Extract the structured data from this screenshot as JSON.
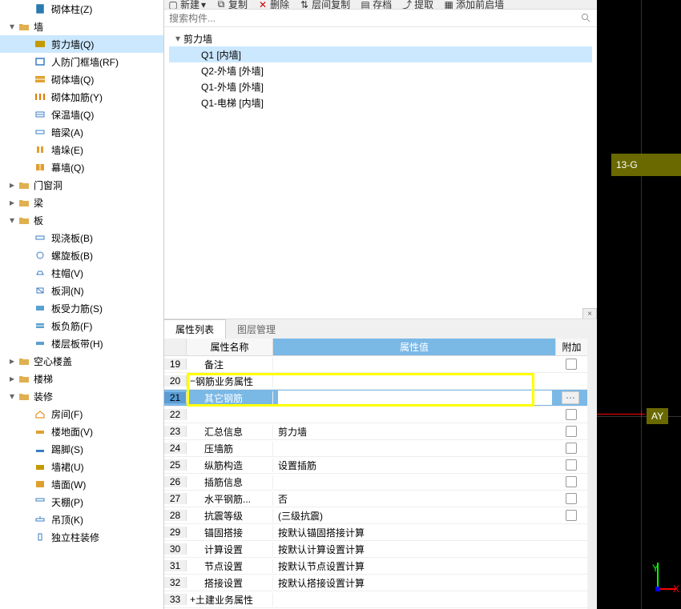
{
  "toolbar": {
    "new": "新建",
    "copy": "复制",
    "delete": "删除",
    "layercopy": "层间复制",
    "save": "存档",
    "extract": "提取",
    "addStartup": "添加前启墙"
  },
  "search": {
    "placeholder": "搜索构件..."
  },
  "left_tree": {
    "masonry_col": "砌体柱(Z)",
    "wall": "墙",
    "wall_children": {
      "shear": "剪力墙(Q)",
      "civil": "人防门框墙(RF)",
      "masonry": "砌体墙(Q)",
      "reinf": "砌体加筋(Y)",
      "insul": "保温墙(Q)",
      "dark": "暗梁(A)",
      "stack": "墙垛(E)",
      "curtain": "幕墙(Q)"
    },
    "door": "门窗洞",
    "beam": "梁",
    "slab": "板",
    "slab_children": {
      "cast": "现浇板(B)",
      "spiral": "螺旋板(B)",
      "cap": "柱帽(V)",
      "hole": "板洞(N)",
      "bar": "板受力筋(S)",
      "neg": "板负筋(F)",
      "strip": "楼层板带(H)"
    },
    "hollow": "空心楼盖",
    "stair": "楼梯",
    "deco": "装修",
    "deco_children": {
      "room": "房间(F)",
      "floor": "楼地面(V)",
      "skirt": "踢脚(S)",
      "wainscot": "墙裙(U)",
      "wallface": "墙面(W)",
      "ceiling": "天棚(P)",
      "suspend": "吊顶(K)",
      "indep": "独立柱装修"
    }
  },
  "comp_tree": {
    "root": "剪力墙",
    "items": {
      "q1in": "Q1 [内墙]",
      "q2out": "Q2-外墙 [外墙]",
      "q1out": "Q1-外墙 [外墙]",
      "q1lift": "Q1-电梯 [内墙]"
    }
  },
  "tabs": {
    "prop": "属性列表",
    "layer": "图层管理"
  },
  "headers": {
    "name": "属性名称",
    "value": "属性值",
    "extra": "附加"
  },
  "rows": [
    {
      "n": "19",
      "name": "备注",
      "value": "",
      "chk": true
    },
    {
      "n": "20",
      "name": "钢筋业务属性",
      "value": "",
      "cat": true
    },
    {
      "n": "21",
      "name": "其它钢筋",
      "value": "",
      "sel": true
    },
    {
      "n": "22",
      "name": "",
      "value": "",
      "chk": true
    },
    {
      "n": "23",
      "name": "汇总信息",
      "value": "剪力墙",
      "chk": true
    },
    {
      "n": "24",
      "name": "压墙筋",
      "value": "",
      "chk": true
    },
    {
      "n": "25",
      "name": "纵筋构造",
      "value": "设置插筋",
      "chk": true
    },
    {
      "n": "26",
      "name": "插筋信息",
      "value": "",
      "chk": true
    },
    {
      "n": "27",
      "name": "水平钢筋...",
      "value": "否",
      "chk": true
    },
    {
      "n": "28",
      "name": "抗震等级",
      "value": "(三级抗震)",
      "chk": true
    },
    {
      "n": "29",
      "name": "锚固搭接",
      "value": "按默认锚固搭接计算"
    },
    {
      "n": "30",
      "name": "计算设置",
      "value": "按默认计算设置计算"
    },
    {
      "n": "31",
      "name": "节点设置",
      "value": "按默认节点设置计算"
    },
    {
      "n": "32",
      "name": "搭接设置",
      "value": "按默认搭接设置计算"
    },
    {
      "n": "33",
      "name": "土建业务属性",
      "value": "",
      "cat": true
    }
  ],
  "cad": {
    "label1": "13-G",
    "label2": "AY",
    "y": "Y",
    "x": "X"
  }
}
